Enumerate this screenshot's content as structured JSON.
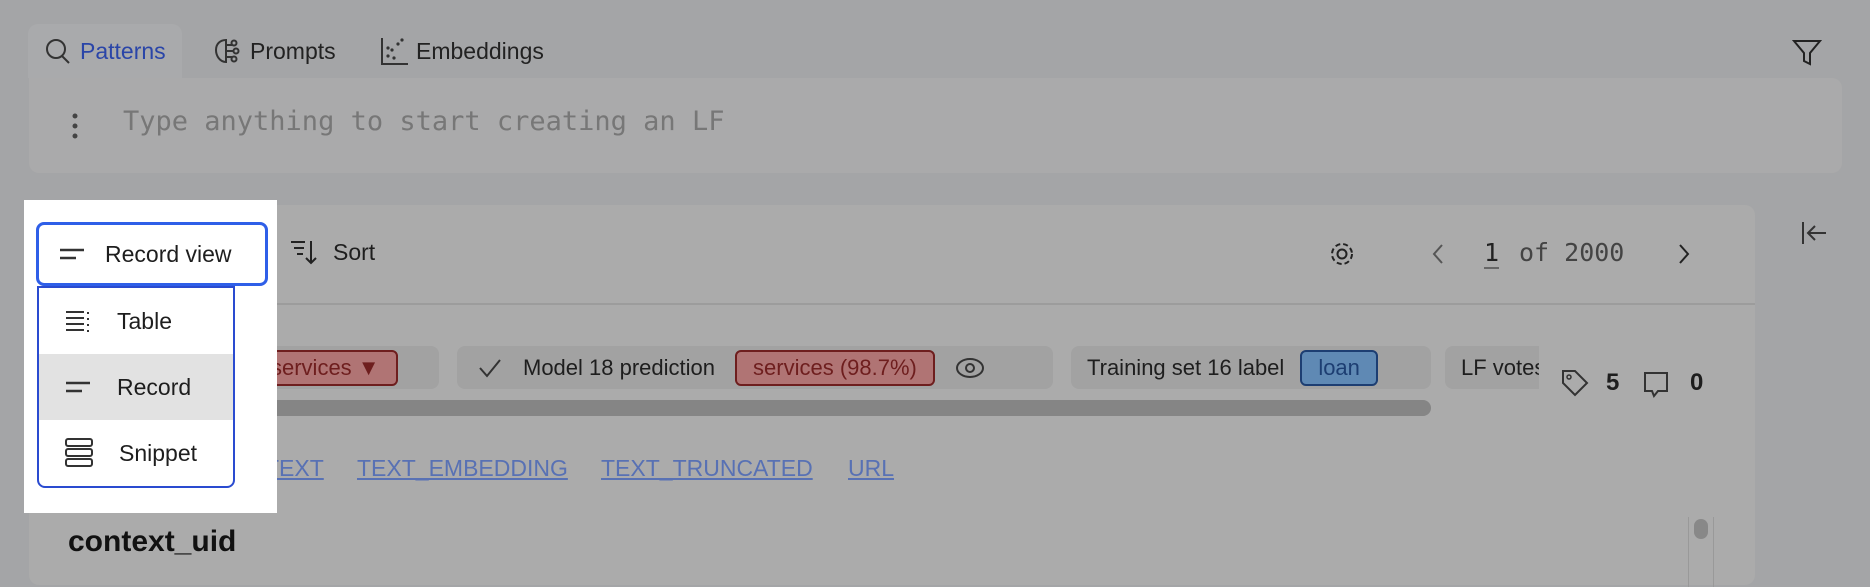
{
  "tabs": [
    {
      "label": "Patterns",
      "icon": "search-icon",
      "active": true
    },
    {
      "label": "Prompts",
      "icon": "brain-icon"
    },
    {
      "label": "Embeddings",
      "icon": "scatter-icon"
    }
  ],
  "input": {
    "placeholder": "Type anything to start creating an LF"
  },
  "toolbar": {
    "view_label": "Record view",
    "sort_label": "Sort",
    "page_current": "1",
    "page_total_label": "of 2000"
  },
  "view_menu": {
    "items": [
      {
        "label": "Table",
        "icon": "table-icon"
      },
      {
        "label": "Record",
        "icon": "record-icon",
        "selected": true
      },
      {
        "label": "Snippet",
        "icon": "snippet-icon"
      }
    ]
  },
  "chips": [
    {
      "badge": "services ▼",
      "badge_color": "#b07474"
    },
    {
      "label": "Model 18 prediction",
      "badge": "services (98.7%)",
      "badge_color": "#b07474"
    },
    {
      "label": "Training set 16 label",
      "badge": "loan",
      "badge_color": "#5f89b4"
    },
    {
      "label": "LF votes"
    }
  ],
  "counts": {
    "tags": "5",
    "comments": "0"
  },
  "fields": [
    "TEXT",
    "TEXT_EMBEDDING",
    "TEXT_TRUNCATED",
    "URL"
  ],
  "record": {
    "field_title": "context_uid"
  }
}
